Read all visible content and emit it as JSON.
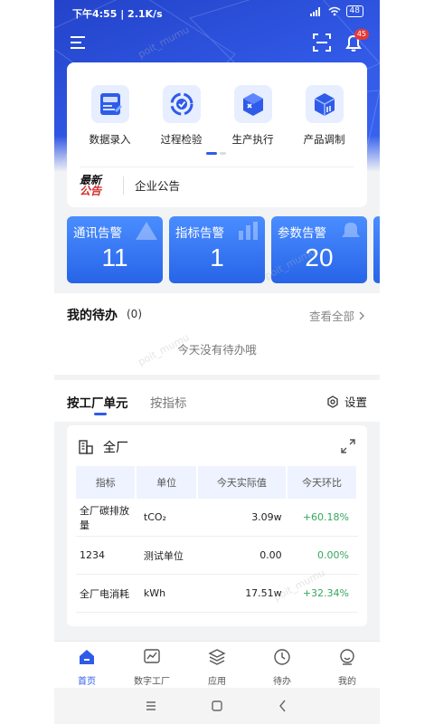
{
  "status_bar": {
    "time_speed": "下午4:55 | 2.1K/s",
    "battery": "48"
  },
  "header": {
    "notification_count": "45"
  },
  "quick_actions": [
    {
      "label": "数据录入",
      "icon": "data-entry-icon"
    },
    {
      "label": "过程检验",
      "icon": "process-inspection-icon"
    },
    {
      "label": "生产执行",
      "icon": "production-execution-icon"
    },
    {
      "label": "产品调制",
      "icon": "product-modulation-icon"
    }
  ],
  "notice": {
    "logo_line1": "最新",
    "logo_line2": "公告",
    "text": "企业公告"
  },
  "alarms": [
    {
      "title": "通讯告警",
      "count": "11"
    },
    {
      "title": "指标告警",
      "count": "1"
    },
    {
      "title": "参数告警",
      "count": "20"
    }
  ],
  "todo": {
    "title": "我的待办",
    "count": "(0)",
    "view_all": "查看全部",
    "empty_text": "今天没有待办哦"
  },
  "stats": {
    "tabs": [
      "按工厂单元",
      "按指标"
    ],
    "settings_label": "设置",
    "card_title": "全厂",
    "columns": [
      "指标",
      "单位",
      "今天实际值",
      "今天环比"
    ],
    "rows": [
      {
        "name": "全厂碳排放量",
        "unit": "tCO₂",
        "value": "3.09w",
        "change": "+60.18%"
      },
      {
        "name": "1234",
        "unit": "测试单位",
        "value": "0.00",
        "change": "0.00%"
      },
      {
        "name": "全厂电消耗",
        "unit": "kWh",
        "value": "17.51w",
        "change": "+32.34%"
      }
    ]
  },
  "bottom_nav": [
    {
      "label": "首页",
      "icon": "home-icon",
      "active": true
    },
    {
      "label": "数字工厂",
      "icon": "digital-factory-icon",
      "active": false
    },
    {
      "label": "应用",
      "icon": "apps-icon",
      "active": false
    },
    {
      "label": "待办",
      "icon": "clock-icon",
      "active": false
    },
    {
      "label": "我的",
      "icon": "profile-icon",
      "active": false
    }
  ],
  "watermark_text": "poit_mumu",
  "colors": {
    "primary": "#2f5bea",
    "positive": "#37a660",
    "badge": "#e53935"
  }
}
